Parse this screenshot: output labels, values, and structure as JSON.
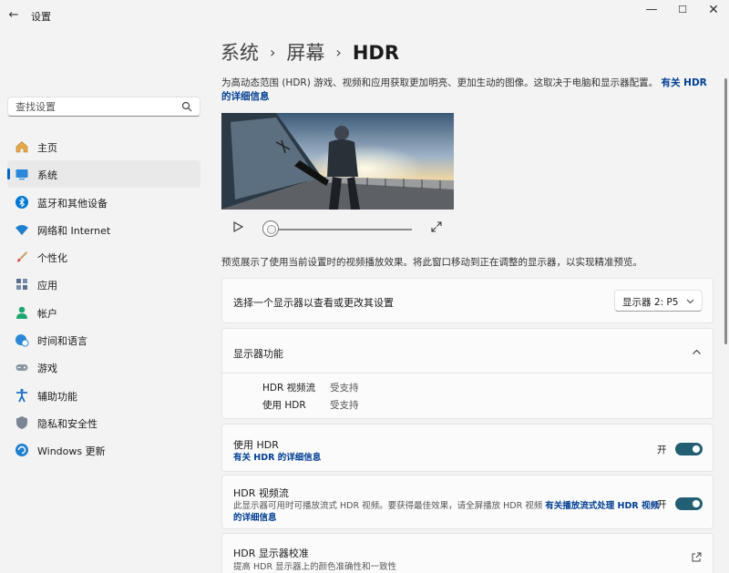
{
  "window": {
    "title": "设置"
  },
  "sidebar": {
    "search_placeholder": "查找设置",
    "items": [
      {
        "label": "主页",
        "icon": "home-icon"
      },
      {
        "label": "系统",
        "icon": "system-icon",
        "active": true
      },
      {
        "label": "蓝牙和其他设备",
        "icon": "bluetooth-icon"
      },
      {
        "label": "网络和 Internet",
        "icon": "wifi-icon"
      },
      {
        "label": "个性化",
        "icon": "brush-icon"
      },
      {
        "label": "应用",
        "icon": "apps-icon"
      },
      {
        "label": "帐户",
        "icon": "account-icon"
      },
      {
        "label": "时间和语言",
        "icon": "globe-clock-icon"
      },
      {
        "label": "游戏",
        "icon": "gamepad-icon"
      },
      {
        "label": "辅助功能",
        "icon": "accessibility-icon"
      },
      {
        "label": "隐私和安全性",
        "icon": "shield-icon"
      },
      {
        "label": "Windows 更新",
        "icon": "update-icon"
      }
    ]
  },
  "breadcrumb": {
    "level1": "系统",
    "level2": "屏幕",
    "current": "HDR"
  },
  "intro": {
    "text": "为高动态范围 (HDR) 游戏、视频和应用获取更加明亮、更加生动的图像。这取决于电脑和显示器配置。",
    "link": "有关 HDR 的详细信息"
  },
  "preview_note": "预览展示了使用当前设置时的视频播放效果。将此窗口移动到正在调整的显示器，以实现精准预览。",
  "display_select": {
    "title": "选择一个显示器以查看或更改其设置",
    "value": "显示器 2: P5"
  },
  "capabilities": {
    "title": "显示器功能",
    "rows": [
      {
        "name": "HDR 视频流",
        "value": "受支持"
      },
      {
        "name": "使用 HDR",
        "value": "受支持"
      }
    ]
  },
  "use_hdr": {
    "title": "使用 HDR",
    "link": "有关 HDR 的详细信息",
    "state": "开"
  },
  "hdr_stream": {
    "title": "HDR 视频流",
    "desc": "此显示器可用时可播放流式 HDR 视频。要获得最佳效果，请全屏播放 HDR 视频",
    "link_part1": "有关播放流式处理 HDR 视频",
    "link_part2": "的详细信息",
    "state": "开"
  },
  "calibration": {
    "title": "HDR 显示器校准",
    "desc": "提高 HDR 显示器上的颜色准确性和一致性"
  },
  "colors": {
    "accent": "#0067c0",
    "toggle_on": "#235f73",
    "link": "#003e92"
  }
}
